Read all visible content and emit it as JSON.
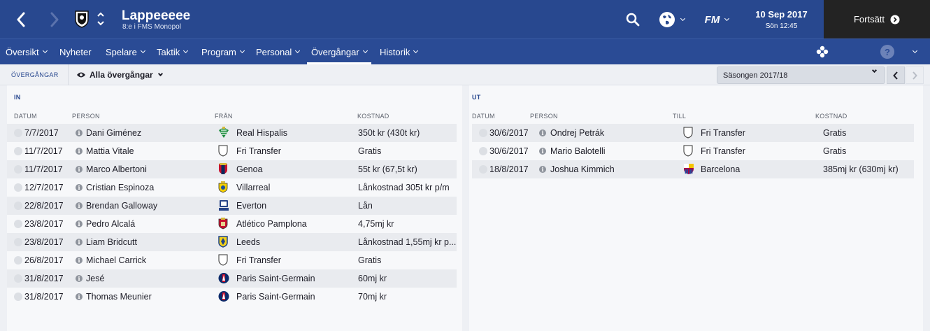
{
  "header": {
    "club_name": "Lappeeeee",
    "club_sub": "8:e i FMS Monopol",
    "date": "10 Sep 2017",
    "day_time": "Sön 12:45",
    "continue_label": "Fortsätt",
    "fm_label": "FM"
  },
  "nav": {
    "items": [
      {
        "label": "Översikt"
      },
      {
        "label": "Nyheter"
      },
      {
        "label": "Spelare"
      },
      {
        "label": "Taktik"
      },
      {
        "label": "Program"
      },
      {
        "label": "Personal"
      },
      {
        "label": "Övergångar"
      },
      {
        "label": "Historik"
      }
    ],
    "help_label": "?"
  },
  "subbar": {
    "section_label": "ÖVERGÅNGAR",
    "filter_label": "Alla övergångar",
    "season_label": "Säsongen 2017/18"
  },
  "transfers_in": {
    "title": "IN",
    "columns": [
      "DATUM",
      "PERSON",
      "FRÅN",
      "KOSTNAD"
    ],
    "rows": [
      {
        "date": "7/7/2017",
        "person": "Dani Giménez",
        "club": "Real Hispalis",
        "cost": "350t kr (430t kr)",
        "crest": "betis-crest"
      },
      {
        "date": "11/7/2017",
        "person": "Mattia Vitale",
        "club": "Fri Transfer",
        "cost": "Gratis",
        "crest": "blank-shield"
      },
      {
        "date": "11/7/2017",
        "person": "Marco Albertoni",
        "club": "Genoa",
        "cost": "55t kr (67,5t kr)",
        "crest": "genoa-crest"
      },
      {
        "date": "12/7/2017",
        "person": "Cristian Espinoza",
        "club": "Villarreal",
        "cost": "Lånkostnad 305t kr p/m",
        "crest": "villarreal-crest"
      },
      {
        "date": "22/8/2017",
        "person": "Brendan Galloway",
        "club": "Everton",
        "cost": "Lån",
        "crest": "everton-crest"
      },
      {
        "date": "23/8/2017",
        "person": "Pedro Alcalá",
        "club": "Atlético Pamplona",
        "cost": "4,75mj kr",
        "crest": "osasuna-crest"
      },
      {
        "date": "23/8/2017",
        "person": "Liam Bridcutt",
        "club": "Leeds",
        "cost": "Lånkostnad 1,55mj kr p...",
        "crest": "leeds-crest"
      },
      {
        "date": "26/8/2017",
        "person": "Michael Carrick",
        "club": "Fri Transfer",
        "cost": "Gratis",
        "crest": "blank-shield"
      },
      {
        "date": "31/8/2017",
        "person": "Jesé",
        "club": "Paris Saint-Germain",
        "cost": "60mj kr",
        "crest": "psg-crest"
      },
      {
        "date": "31/8/2017",
        "person": "Thomas Meunier",
        "club": "Paris Saint-Germain",
        "cost": "70mj kr",
        "crest": "psg-crest"
      }
    ]
  },
  "transfers_out": {
    "title": "UT",
    "columns": [
      "DATUM",
      "PERSON",
      "TILL",
      "KOSTNAD"
    ],
    "rows": [
      {
        "date": "30/6/2017",
        "person": "Ondrej Petrák",
        "club": "Fri Transfer",
        "cost": "Gratis",
        "crest": "blank-shield"
      },
      {
        "date": "30/6/2017",
        "person": "Mario Balotelli",
        "club": "Fri Transfer",
        "cost": "Gratis",
        "crest": "blank-shield"
      },
      {
        "date": "18/8/2017",
        "person": "Joshua Kimmich",
        "club": "Barcelona",
        "cost": "385mj kr (630mj kr)",
        "crest": "barcelona-crest"
      }
    ]
  },
  "colors": {
    "header_blue": "#28488f",
    "dark_panel": "#232323",
    "accent_text": "#28488f"
  }
}
